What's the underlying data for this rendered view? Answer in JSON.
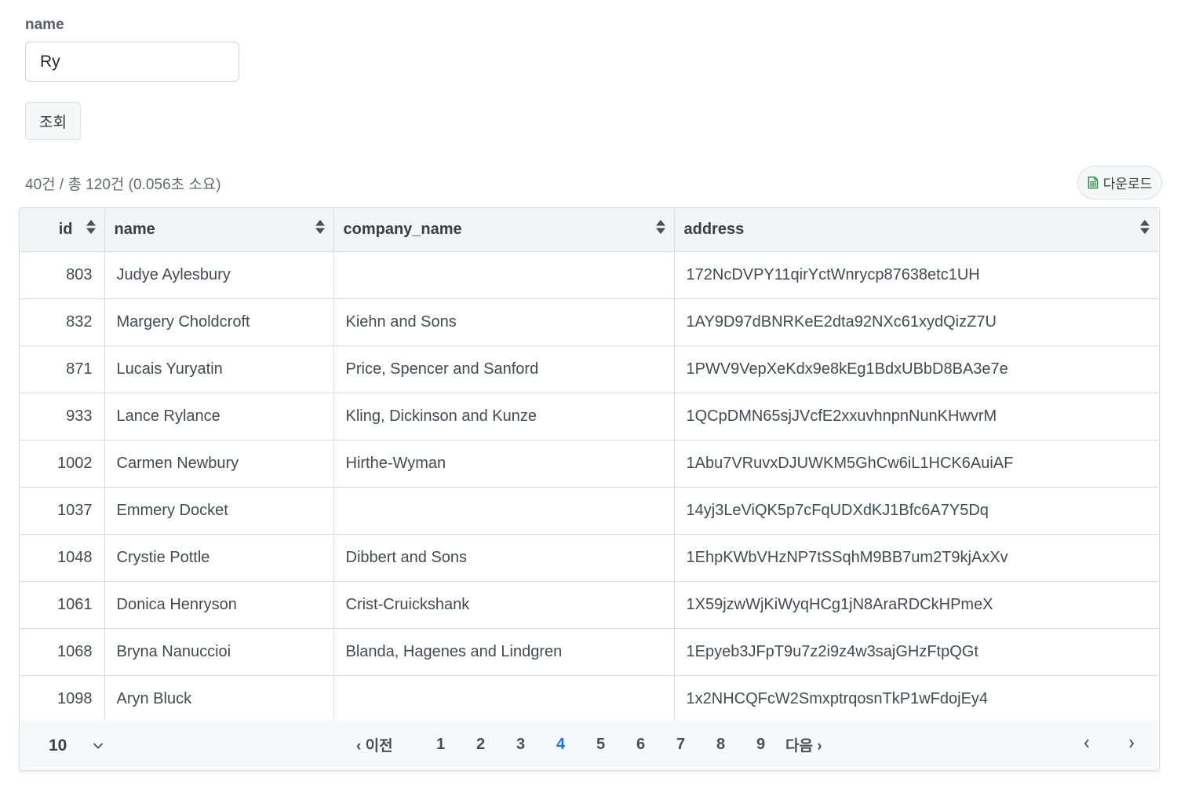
{
  "filter": {
    "label": "name",
    "value": "Ry",
    "search_label": "조회"
  },
  "result_info": "40건 / 총 120건 (0.056초 소요)",
  "download_label": "다운로드",
  "table": {
    "columns": [
      "id",
      "name",
      "company_name",
      "address"
    ],
    "rows": [
      {
        "id": "803",
        "name": "Judye Aylesbury",
        "company": "",
        "address": "172NcDVPY11qirYctWnrycp87638etc1UH"
      },
      {
        "id": "832",
        "name": "Margery Choldcroft",
        "company": "Kiehn and Sons",
        "address": "1AY9D97dBNRKeE2dta92NXc61xydQizZ7U"
      },
      {
        "id": "871",
        "name": "Lucais Yuryatin",
        "company": "Price, Spencer and Sanford",
        "address": "1PWV9VepXeKdx9e8kEg1BdxUBbD8BA3e7e"
      },
      {
        "id": "933",
        "name": "Lance Rylance",
        "company": "Kling, Dickinson and Kunze",
        "address": "1QCpDMN65sjJVcfE2xxuvhnpnNunKHwvrM"
      },
      {
        "id": "1002",
        "name": "Carmen Newbury",
        "company": "Hirthe-Wyman",
        "address": "1Abu7VRuvxDJUWKM5GhCw6iL1HCK6AuiAF"
      },
      {
        "id": "1037",
        "name": "Emmery Docket",
        "company": "",
        "address": "14yj3LeViQK5p7cFqUDXdKJ1Bfc6A7Y5Dq"
      },
      {
        "id": "1048",
        "name": "Crystie Pottle",
        "company": "Dibbert and Sons",
        "address": "1EhpKWbVHzNP7tSSqhM9BB7um2T9kjAxXv"
      },
      {
        "id": "1061",
        "name": "Donica Henryson",
        "company": "Crist-Cruickshank",
        "address": "1X59jzwWjKiWyqHCg1jN8AraRDCkHPmeX"
      },
      {
        "id": "1068",
        "name": "Bryna Nanuccioi",
        "company": "Blanda, Hagenes and Lindgren",
        "address": "1Epyeb3JFpT9u7z2i9z4w3sajGHzFtpQGt"
      },
      {
        "id": "1098",
        "name": "Aryn Bluck",
        "company": "",
        "address": "1x2NHCQFcW2SmxptrqosnTkP1wFdojEy4"
      }
    ]
  },
  "pagination": {
    "page_size": "10",
    "prev_label": "‹ 이전",
    "next_label": "다음 ›",
    "pages": [
      "1",
      "2",
      "3",
      "4",
      "5",
      "6",
      "7",
      "8",
      "9"
    ],
    "current_page": "4"
  },
  "colors": {
    "active_page": "#1a73e8",
    "header_bg": "#f3f4f6",
    "border": "#d8dbe0"
  }
}
